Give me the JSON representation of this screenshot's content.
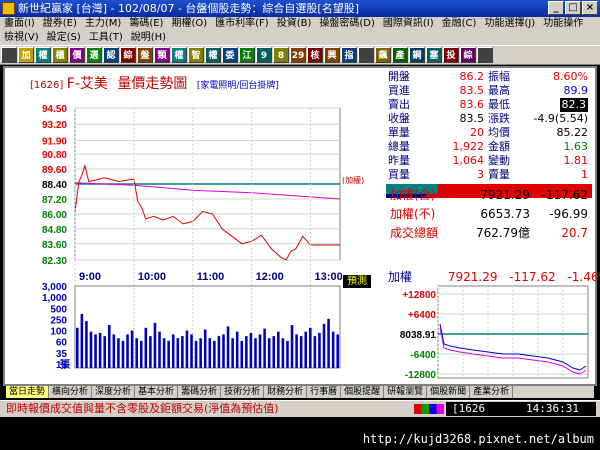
{
  "window": {
    "title": "新世紀贏家 [台灣] - 102/08/07 - 台盤個股走勢：綜合自選股[名望股]",
    "controls": [
      "_",
      "□",
      "×"
    ]
  },
  "menu_row1": [
    "畫面(I)",
    "證券(E)",
    "主力(M)",
    "籌碼(E)",
    "期權(O)",
    "匯市利率(F)",
    "投資(B)",
    "操盤密碼(D)",
    "國際資訊(I)",
    "金融(C)",
    "功能選擇(J)",
    "功能操作"
  ],
  "menu_row2": [
    "檢視(V)",
    "設定(S)",
    "工具(T)",
    "說明(H)"
  ],
  "toolbar": [
    "",
    "加",
    "權",
    "櫃",
    "價",
    "選",
    "認",
    "綜",
    "盤",
    "類",
    "權",
    "智",
    "權",
    "委",
    "江",
    "9",
    "8",
    "29",
    "核",
    "興",
    "指",
    "",
    "飆",
    "產",
    "鋼",
    "塞",
    "投",
    "綜",
    ""
  ],
  "stock": {
    "code": "[1626]",
    "name": "F-艾美",
    "chart_title": "量價走勢圖",
    "links": "[家電照明/回台掛牌]",
    "side_label": "(加權)",
    "warn_label": "預測"
  },
  "quotes": {
    "rows": [
      [
        "開盤",
        "86.2",
        "振幅",
        "8.60%"
      ],
      [
        "買進",
        "83.5",
        "最高",
        "89.9"
      ],
      [
        "賣出",
        "83.6",
        "最低",
        "82.3"
      ],
      [
        "收盤",
        "83.5",
        "漲跌",
        "-4.9(5.54)"
      ],
      [
        "單量",
        "20",
        "均價",
        "85.22"
      ],
      [
        "總量",
        "1,922",
        "金額",
        "1.63"
      ],
      [
        "昨量",
        "1,064",
        "變動",
        "1.81"
      ],
      [
        "買量",
        "3",
        "賣量",
        "1"
      ]
    ],
    "index_rows": [
      [
        "加權(含)",
        "7921.29",
        "-117.62"
      ],
      [
        "加權(不)",
        "6653.73",
        "-96.99"
      ],
      [
        "成交總額",
        "762.79億",
        "20.7"
      ]
    ],
    "mini": {
      "title": "加權",
      "value": "7921.29",
      "change": "-117.62",
      "pct": "-1.46%",
      "center": "8038.91",
      "ticks": [
        "+12800",
        "+6400",
        "-6400",
        "-12800"
      ]
    }
  },
  "tabs": [
    "當日走勢",
    "橫向分析",
    "深度分析",
    "基本分析",
    "籌碼分析",
    "技術分析",
    "財務分析",
    "行事曆",
    "個股提醒",
    "研報瀏覽",
    "個股新聞",
    "產業分析"
  ],
  "status": {
    "message": "即時報價成交值與量不含零股及鉅額交易(淨值為預估值)",
    "code": "[1626",
    "time": "14:36:31"
  },
  "footer": {
    "url": "http://kujd3268.pixnet.net/album"
  },
  "chart_data": {
    "type": "line",
    "title": "量價走勢圖",
    "y_ticks": [
      "94.50",
      "93.20",
      "91.90",
      "90.80",
      "89.60",
      "88.40",
      "87.20",
      "86.00",
      "84.80",
      "83.60",
      "82.30"
    ],
    "ylim": [
      82.3,
      94.5
    ],
    "ref_close": 88.4,
    "x_ticks": [
      "9:00",
      "10:00",
      "11:00",
      "12:00",
      "13:00"
    ],
    "price": [
      [
        0,
        86.2
      ],
      [
        4,
        88.6
      ],
      [
        8,
        89.3
      ],
      [
        10,
        89.9
      ],
      [
        14,
        88.6
      ],
      [
        20,
        88.7
      ],
      [
        30,
        88.9
      ],
      [
        45,
        88.6
      ],
      [
        60,
        88.8
      ],
      [
        64,
        87.0
      ],
      [
        68,
        86.5
      ],
      [
        72,
        85.6
      ],
      [
        80,
        85.8
      ],
      [
        90,
        85.5
      ],
      [
        100,
        85.8
      ],
      [
        110,
        85.2
      ],
      [
        120,
        85.4
      ],
      [
        130,
        86.2
      ],
      [
        140,
        86.0
      ],
      [
        150,
        84.8
      ],
      [
        160,
        84.2
      ],
      [
        170,
        83.6
      ],
      [
        180,
        83.8
      ],
      [
        190,
        84.3
      ],
      [
        200,
        83.2
      ],
      [
        210,
        82.5
      ],
      [
        215,
        82.3
      ],
      [
        220,
        83.0
      ],
      [
        225,
        83.2
      ],
      [
        232,
        84.2
      ],
      [
        240,
        83.5
      ],
      [
        270,
        83.5
      ]
    ],
    "index_line": [
      [
        0,
        88.5
      ],
      [
        60,
        88.3
      ],
      [
        120,
        87.9
      ],
      [
        180,
        87.7
      ],
      [
        270,
        87.2
      ]
    ],
    "volume_ticks": [
      "3,000",
      "1,000",
      "500",
      "250",
      "100",
      "60",
      "35",
      "15"
    ],
    "volume_unit": "張",
    "volume": [
      60,
      250,
      120,
      40,
      30,
      35,
      25,
      80,
      30,
      20,
      15,
      30,
      45,
      20,
      15,
      60,
      25,
      100,
      40,
      20,
      15,
      30,
      20,
      25,
      45,
      30,
      15,
      20,
      50,
      20,
      15,
      25,
      30,
      70,
      20,
      40,
      15,
      25,
      35,
      20,
      30,
      55,
      20,
      25,
      40,
      20,
      15,
      80,
      30,
      25,
      40,
      60,
      25,
      35,
      90,
      150,
      40,
      30
    ]
  }
}
